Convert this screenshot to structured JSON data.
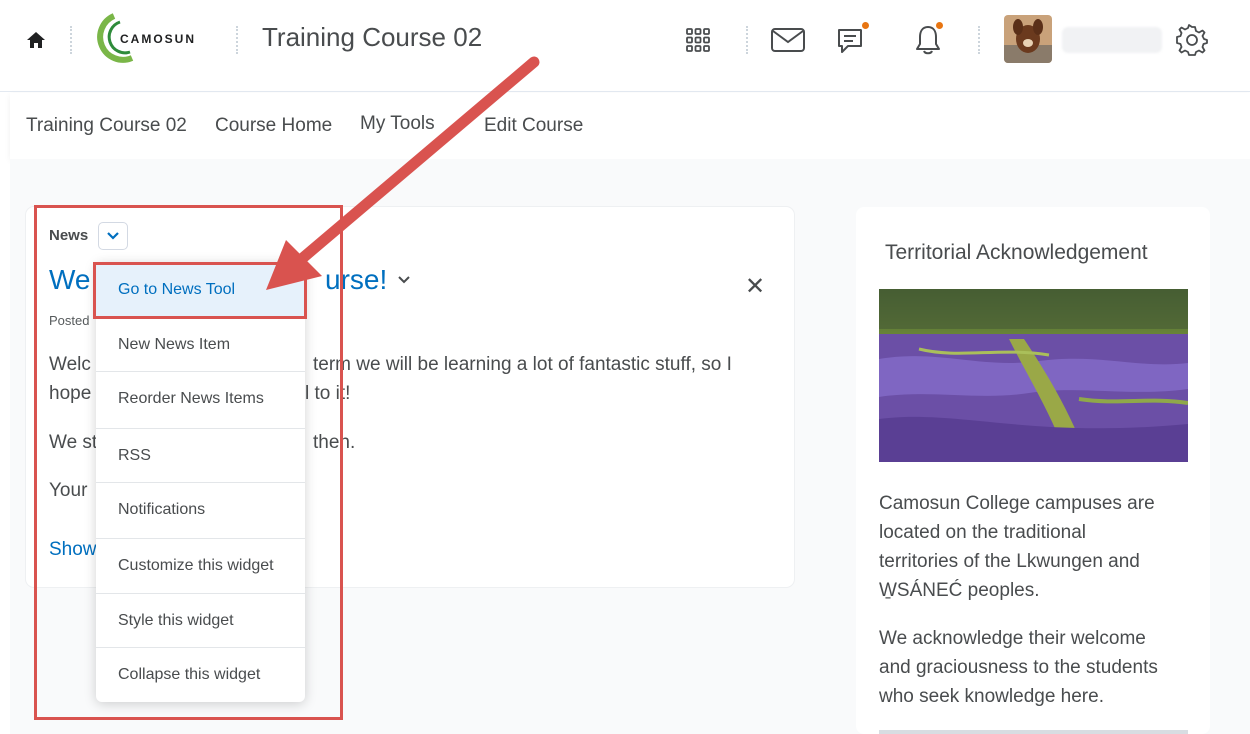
{
  "topbar": {
    "logo_text": "CAMOSUN",
    "course_title": "Training Course 02",
    "icons": [
      "home-icon",
      "camosun-logo",
      "waffle-grid-icon",
      "envelope-icon",
      "chat-bubble-icon",
      "bell-icon",
      "avatar",
      "gear-icon"
    ]
  },
  "navbar": {
    "items": [
      "Training Course 02",
      "Course Home",
      "My Tools",
      "Edit Course"
    ]
  },
  "news": {
    "heading": "News",
    "item_title_start": "We",
    "item_title_end": "urse!",
    "posted": "Posted",
    "close": "✕",
    "line1_start": "Welc",
    "line1_end": "term we will be learning a lot of fantastic stuff, so I",
    "line2_start": "hope",
    "line2_end": "l to it!",
    "line3_start": "We st",
    "line3_end": "then.",
    "line4_start": "Your",
    "show_link": "Show"
  },
  "menu": {
    "items": [
      "Go to News Tool",
      "New News Item",
      "Reorder News Items",
      "RSS",
      "Notifications",
      "Customize this widget",
      "Style this widget",
      "Collapse this widget"
    ]
  },
  "territorial": {
    "title": "Territorial Acknowledgement",
    "p1_lines": [
      "Camosun College campuses are",
      "located on the traditional",
      "territories of the Lkwungen and",
      "W̱SÁNEĆ peoples."
    ],
    "p2_lines": [
      "We acknowledge their welcome",
      "and graciousness to the students",
      "who seek knowledge here."
    ]
  },
  "colors": {
    "accent": "#006fbf",
    "annotation": "#d9534f",
    "badge": "#e87511"
  }
}
